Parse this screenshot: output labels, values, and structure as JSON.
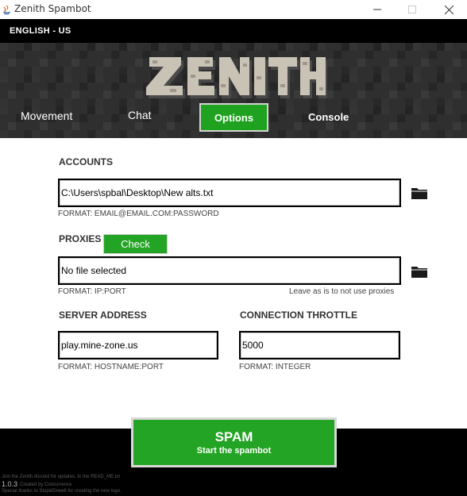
{
  "window": {
    "title": "Zenith Spambot",
    "icons": [
      "java-icon",
      "minimize-icon",
      "maximize-icon",
      "close-icon"
    ]
  },
  "language": {
    "label": "ENGLISH - US"
  },
  "header": {
    "logo_text": "ZENITH",
    "tabs": [
      {
        "label": "Movement",
        "active": false
      },
      {
        "label": "Chat",
        "active": false
      },
      {
        "label": "Options",
        "active": true
      },
      {
        "label": "Console",
        "active": false
      }
    ]
  },
  "accounts": {
    "label": "ACCOUNTS",
    "value": "C:\\Users\\spbal\\Desktop\\New alts.txt",
    "format": "FORMAT: EMAIL@EMAIL.COM:PASSWORD",
    "icon": "folder-icon"
  },
  "proxies": {
    "label": "PROXIES",
    "check_label": "Check",
    "value": "No file selected",
    "format": "FORMAT: IP:PORT",
    "note": "Leave as is to not use proxies",
    "icon": "folder-icon"
  },
  "server": {
    "label": "SERVER ADDRESS",
    "value": "play.mine-zone.us",
    "format": "FORMAT: HOSTNAME:PORT"
  },
  "throttle": {
    "label": "CONNECTION THROTTLE",
    "value": "5000",
    "format": "FORMAT: INTEGER"
  },
  "spam": {
    "title": "SPAM",
    "subtitle": "Start the spambot"
  },
  "footer": {
    "discord_note": "Join the Zenith discord for updates. In the READ_ME.txt",
    "version": "1.0.3",
    "created_by": "Created by Concurrence",
    "thanks": "Special thanks to StupidDrew6 for creating the new logo."
  },
  "colors": {
    "accent_green": "#24a424",
    "active_tab_green": "#1fa21f",
    "bar_black": "#000000",
    "header_dark": "#2d2d2d"
  }
}
